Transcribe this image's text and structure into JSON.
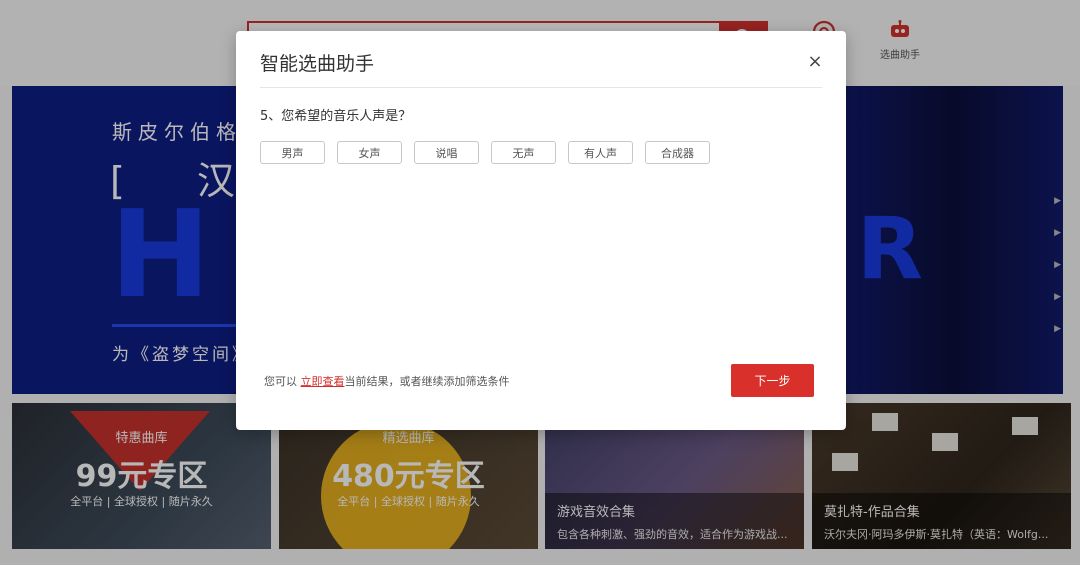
{
  "header": {
    "robot_label": "选曲助手"
  },
  "hero": {
    "line1": "斯皮尔伯格",
    "line2": "[ 汉斯",
    "big": "HA",
    "big_right": "R",
    "line3": "为《盗梦空间》"
  },
  "cards": [
    {
      "tag": "特惠曲库",
      "price": "99元专区",
      "sub": "全平台 | 全球授权 | 随片永久"
    },
    {
      "tag": "精选曲库",
      "price": "480元专区",
      "sub": "全平台 | 全球授权 | 随片永久"
    },
    {
      "title": "游戏音效合集",
      "desc": "包含各种刺激、强劲的音效，适合作为游戏战..."
    },
    {
      "title": "莫扎特-作品合集",
      "desc": "沃尔夫冈·阿玛多伊斯·莫扎特（英语：Wolfg..."
    }
  ],
  "modal": {
    "title": "智能选曲助手",
    "close_symbol": "×",
    "question": "5、您希望的音乐人声是？",
    "options": [
      "男声",
      "女声",
      "说唱",
      "无声",
      "有人声",
      "合成器"
    ],
    "footer_prefix": "您可以 ",
    "footer_link": "立即查看",
    "footer_suffix": "当前结果，或者继续添加筛选条件",
    "next_label": "下一步"
  },
  "colors": {
    "accent": "#d9302b",
    "hero_bg": "#0f1e86"
  }
}
